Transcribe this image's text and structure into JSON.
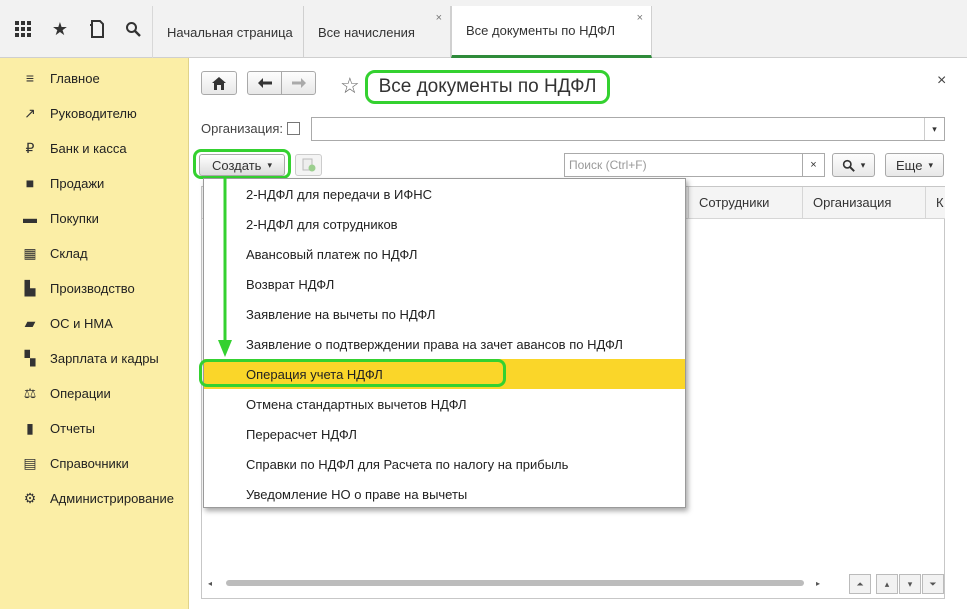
{
  "tabs": [
    {
      "label": "Начальная страница",
      "closable": false
    },
    {
      "label": "Все начисления",
      "closable": true
    },
    {
      "label": "Все документы по НДФЛ",
      "closable": true,
      "active": true
    }
  ],
  "close_glyph": "×",
  "sidebar": {
    "items": [
      {
        "label": "Главное",
        "icon": "menu-lines-icon"
      },
      {
        "label": "Руководителю",
        "icon": "trend-icon"
      },
      {
        "label": "Банк и касса",
        "icon": "ruble-icon"
      },
      {
        "label": "Продажи",
        "icon": "shopping-bag-icon"
      },
      {
        "label": "Покупки",
        "icon": "cart-icon"
      },
      {
        "label": "Склад",
        "icon": "warehouse-icon"
      },
      {
        "label": "Производство",
        "icon": "factory-icon"
      },
      {
        "label": "ОС и НМА",
        "icon": "truck-icon"
      },
      {
        "label": "Зарплата и кадры",
        "icon": "people-icon"
      },
      {
        "label": "Операции",
        "icon": "operations-icon"
      },
      {
        "label": "Отчеты",
        "icon": "bar-chart-icon"
      },
      {
        "label": "Справочники",
        "icon": "book-icon"
      },
      {
        "label": "Администрирование",
        "icon": "gear-icon"
      }
    ]
  },
  "main": {
    "title": "Все документы по НДФЛ",
    "org_label": "Организация:",
    "org_value": "",
    "create_label": "Создать",
    "search_placeholder": "Поиск (Ctrl+F)",
    "more_label": "Еще",
    "columns": [
      "Сотрудники",
      "Организация",
      "К"
    ]
  },
  "dropdown": {
    "items": [
      {
        "label": "2-НДФЛ для передачи в ИФНС"
      },
      {
        "label": "2-НДФЛ для сотрудников"
      },
      {
        "label": "Авансовый платеж по НДФЛ"
      },
      {
        "label": "Возврат НДФЛ"
      },
      {
        "label": "Заявление на вычеты по НДФЛ"
      },
      {
        "label": "Заявление о подтверждении права на зачет авансов по НДФЛ"
      },
      {
        "label": "Операция учета НДФЛ",
        "selected": true
      },
      {
        "label": "Отмена стандартных вычетов НДФЛ"
      },
      {
        "label": "Перерасчет НДФЛ"
      },
      {
        "label": "Справки по НДФЛ для Расчета по налогу на прибыль"
      },
      {
        "label": "Уведомление НО о праве на вычеты"
      }
    ]
  },
  "colors": {
    "sidebar_bg": "#fbeea6",
    "selected_item": "#fad629",
    "highlight": "#34d130",
    "active_tab_underline": "#2e8b3a"
  }
}
